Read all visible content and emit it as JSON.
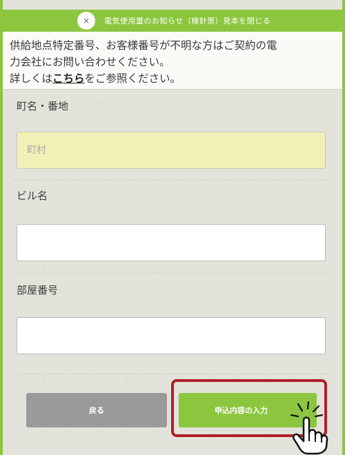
{
  "close_bar": {
    "close_symbol": "×",
    "text": "電気使用量のお知らせ（検針票）見本を閉じる"
  },
  "notice": {
    "line1": "供給地点特定番号、お客様番号が不明な方はご契約の電",
    "line2": "力会社にお問い合わせください。",
    "line3_prefix": "詳しくは",
    "link": "こちら",
    "line3_suffix": "をご参照ください。"
  },
  "form": {
    "town_label": "町名・番地",
    "town_placeholder": "町村",
    "building_label": "ビル名",
    "building_value": "",
    "room_label": "部屋番号",
    "room_value": ""
  },
  "buttons": {
    "back": "戻る",
    "apply": "申込内容の入力"
  },
  "colors": {
    "accent_green": "#8cc63f",
    "highlight_red": "#b01e2a",
    "field_yellow": "#f2f0b6",
    "back_gray": "#9a9a9a"
  },
  "icons": {
    "close": "close-icon",
    "pointer": "pointing-hand-icon"
  }
}
